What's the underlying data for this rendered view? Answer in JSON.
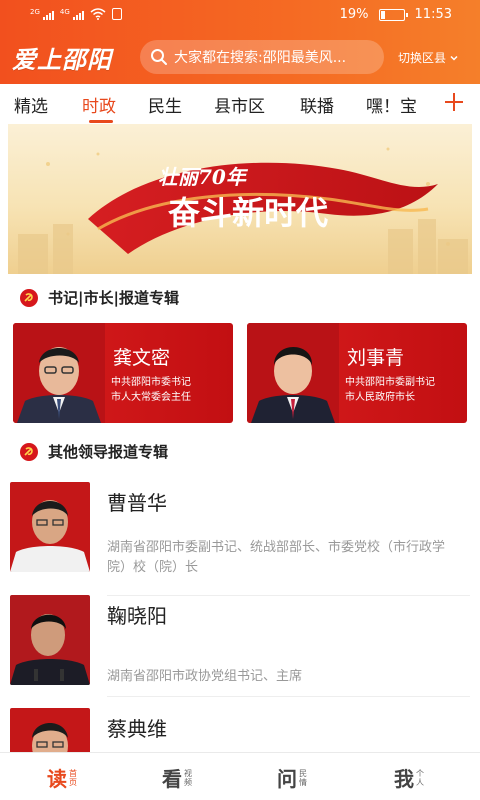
{
  "status": {
    "battery": "19%",
    "time": "11:53",
    "sim1": "2G",
    "sim2": "4G",
    "battery_level": 0.19
  },
  "header": {
    "logo": "爱上邵阳",
    "search_placeholder": "大家都在搜索:邵阳最美风...",
    "switch_label": "切换区县"
  },
  "tabs": [
    "精选",
    "时政",
    "民生",
    "县市区",
    "联播",
    "嘿！宝"
  ],
  "active_tab": "时政",
  "banner": {
    "line1": "壮丽70年",
    "line2": "奋斗新时代"
  },
  "section1": {
    "title": "书记|市长|报道专辑"
  },
  "leaders": [
    {
      "name": "龚文密",
      "desc1": "中共邵阳市委书记",
      "desc2": "市人大常委会主任"
    },
    {
      "name": "刘事青",
      "desc1": "中共邵阳市委副书记",
      "desc2": "市人民政府市长"
    }
  ],
  "section2": {
    "title": "其他领导报道专辑"
  },
  "others": [
    {
      "name": "曹普华",
      "desc": "湖南省邵阳市委副书记、统战部部长、市委党校（市行政学院）校（院）长"
    },
    {
      "name": "鞠晓阳",
      "desc": "湖南省邵阳市政协党组书记、主席"
    },
    {
      "name": "蔡典维",
      "desc": ""
    }
  ],
  "bottom_nav": [
    {
      "big": "读",
      "small": "首页"
    },
    {
      "big": "看",
      "small": "视频"
    },
    {
      "big": "问",
      "small": "民情"
    },
    {
      "big": "我",
      "small": "个人"
    }
  ],
  "colors": {
    "accent": "#e8491d",
    "card_red": "#d81d1d",
    "header_start": "#f2501e",
    "header_end": "#f57f2a"
  }
}
